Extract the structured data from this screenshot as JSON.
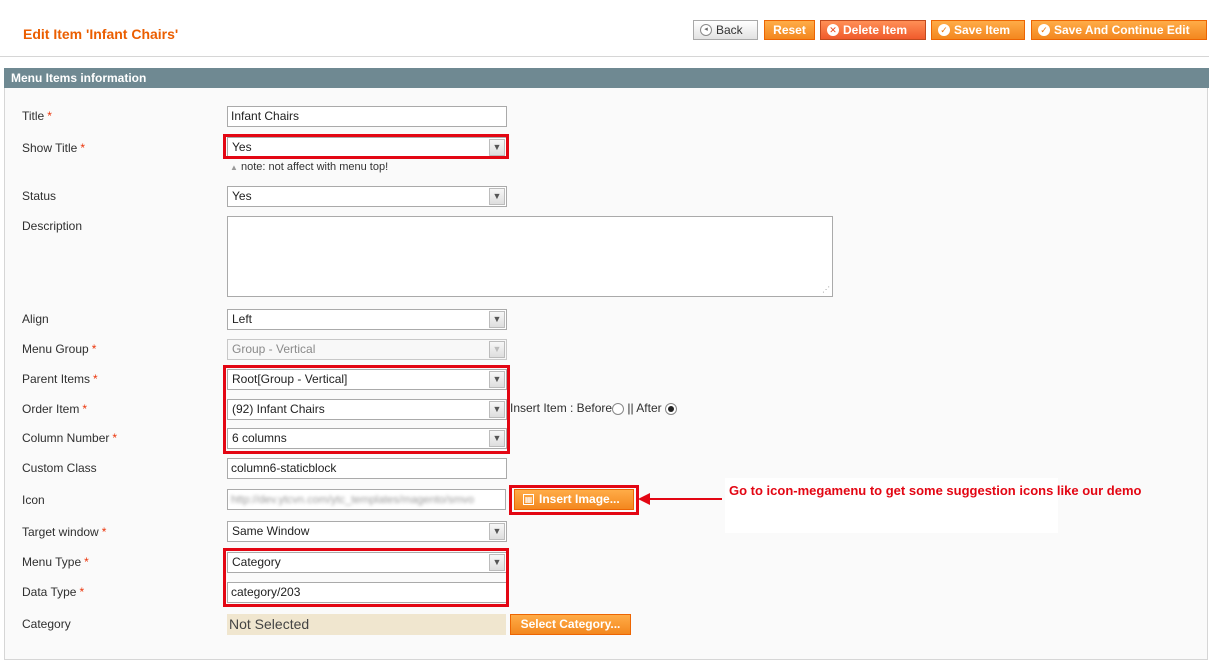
{
  "header": {
    "title": "Edit Item 'Infant Chairs'",
    "buttons": {
      "back": "Back",
      "reset": "Reset",
      "delete": "Delete Item",
      "save": "Save Item",
      "save_continue": "Save And Continue Edit"
    }
  },
  "section": {
    "title": "Menu Items information"
  },
  "form": {
    "title": {
      "label": "Title",
      "value": "Infant Chairs"
    },
    "show_title": {
      "label": "Show Title",
      "value": "Yes",
      "note": "note: not affect with menu top!"
    },
    "status": {
      "label": "Status",
      "value": "Yes"
    },
    "description": {
      "label": "Description",
      "value": ""
    },
    "align": {
      "label": "Align",
      "value": "Left"
    },
    "menu_group": {
      "label": "Menu Group",
      "value": "Group - Vertical"
    },
    "parent_items": {
      "label": "Parent Items",
      "value": "Root[Group - Vertical]"
    },
    "order_item": {
      "label": "Order Item",
      "value": "(92) Infant Chairs",
      "insert_label": "Insert Item : Before",
      "after_label": "|| After",
      "selected": "after"
    },
    "column_number": {
      "label": "Column Number",
      "value": "6 columns"
    },
    "custom_class": {
      "label": "Custom Class",
      "value": "column6-staticblock"
    },
    "icon": {
      "label": "Icon",
      "value": "http://dev.ytcvn.com/ytc_templates/magento/smvo",
      "button": "Insert Image..."
    },
    "target_window": {
      "label": "Target window",
      "value": "Same Window"
    },
    "menu_type": {
      "label": "Menu Type",
      "value": "Category"
    },
    "data_type": {
      "label": "Data Type",
      "value": "category/203"
    },
    "category": {
      "label": "Category",
      "value": "Not Selected",
      "button": "Select Category..."
    }
  },
  "annotation": {
    "text": "Go to icon-megamenu to get some suggestion icons like our demo"
  },
  "colors": {
    "accent": "#eb5e00",
    "section_header": "#6f8992",
    "highlight": "#e30613"
  }
}
